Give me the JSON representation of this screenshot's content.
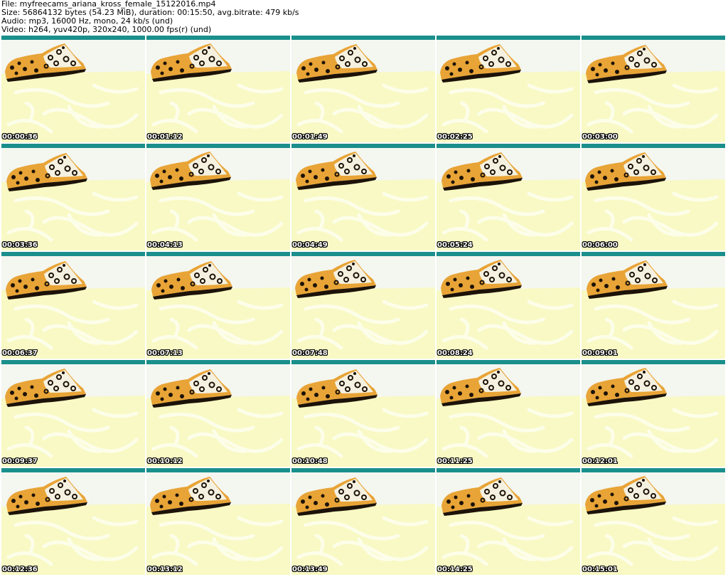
{
  "info": {
    "file": "File: myfreecams_ariana_kross_female_15122016.mp4",
    "size": "Size: 56864132 bytes (54.23 MiB), duration: 00:15:50, avg.bitrate: 479 kb/s",
    "audio": "Audio: mp3, 16000 Hz, mono, 24 kb/s (und)",
    "video": "Video: h264, yuv420p, 320x240, 1000.00 fps(r) (und)"
  },
  "colors": {
    "teal_bar": "#1a8f8c",
    "wall": "#f4f6f0",
    "floor": "#f8f9c4",
    "floor_pattern": "#fdfee9",
    "leopard_base": "#e8a436",
    "leopard_spot": "#1c1208",
    "leopard_light": "#f5f1e0"
  },
  "thumbnails": [
    {
      "timestamp": "00:00:36"
    },
    {
      "timestamp": "00:01:12"
    },
    {
      "timestamp": "00:01:49"
    },
    {
      "timestamp": "00:02:25"
    },
    {
      "timestamp": "00:03:00"
    },
    {
      "timestamp": "00:03:36"
    },
    {
      "timestamp": "00:04:13"
    },
    {
      "timestamp": "00:04:49"
    },
    {
      "timestamp": "00:05:24"
    },
    {
      "timestamp": "00:06:00"
    },
    {
      "timestamp": "00:06:37"
    },
    {
      "timestamp": "00:07:13"
    },
    {
      "timestamp": "00:07:48"
    },
    {
      "timestamp": "00:08:24"
    },
    {
      "timestamp": "00:09:01"
    },
    {
      "timestamp": "00:09:37"
    },
    {
      "timestamp": "00:10:12"
    },
    {
      "timestamp": "00:10:48"
    },
    {
      "timestamp": "00:11:25"
    },
    {
      "timestamp": "00:12:01"
    },
    {
      "timestamp": "00:12:36"
    },
    {
      "timestamp": "00:13:12"
    },
    {
      "timestamp": "00:13:49"
    },
    {
      "timestamp": "00:14:25"
    },
    {
      "timestamp": "00:15:01"
    }
  ]
}
